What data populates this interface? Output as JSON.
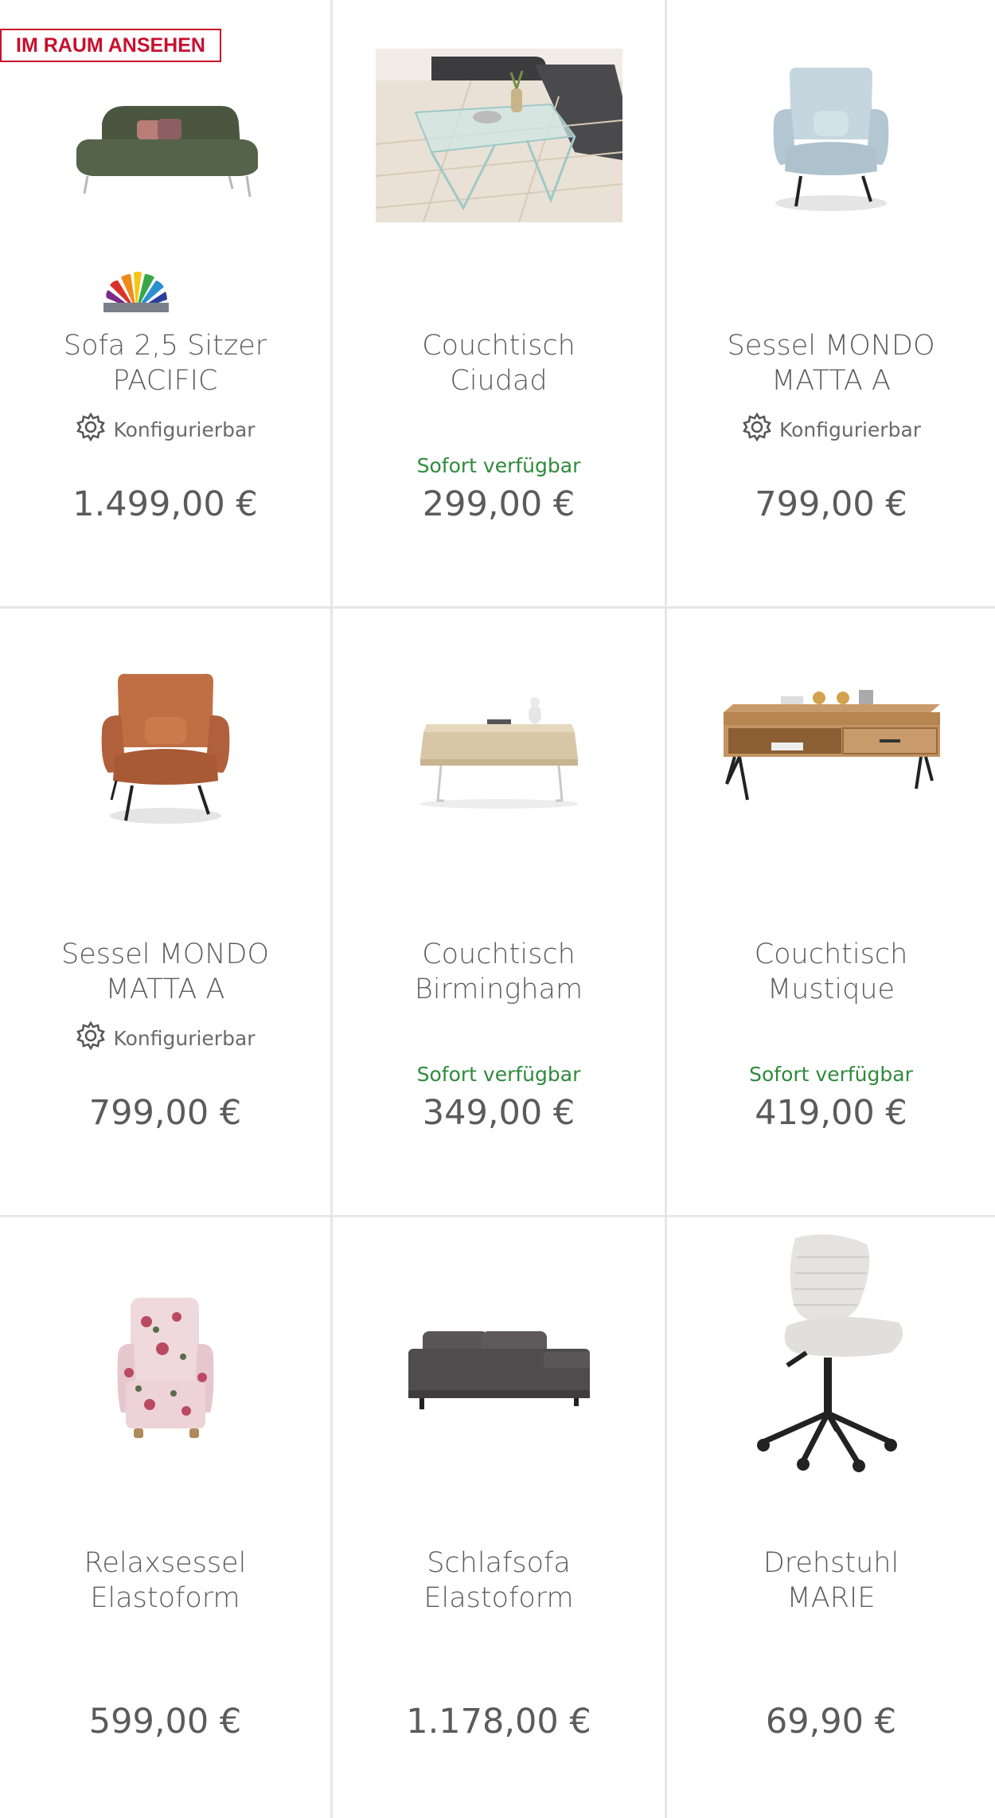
{
  "products": [
    {
      "badge": "IM RAUM ANSEHEN",
      "title_line1": "Sofa 2,5 Sitzer",
      "title_line2": "PACIFIC",
      "config_label": "Konfigurierbar",
      "availability": "",
      "price": "1.499,00 €",
      "image_icon": "sofa-green-image",
      "color_icon": "color-fan-icon"
    },
    {
      "title_line1": "Couchtisch",
      "title_line2": "Ciudad",
      "config_label": "",
      "availability": "Sofort verfügbar",
      "price": "299,00 €",
      "image_icon": "glass-coffee-table-image"
    },
    {
      "title_line1": "Sessel MONDO",
      "title_line2": "MATTA A",
      "config_label": "Konfigurierbar",
      "availability": "",
      "price": "799,00 €",
      "image_icon": "armchair-lightblue-image"
    },
    {
      "title_line1": "Sessel MONDO",
      "title_line2": "MATTA A",
      "config_label": "Konfigurierbar",
      "availability": "",
      "price": "799,00 €",
      "image_icon": "armchair-copper-image"
    },
    {
      "title_line1": "Couchtisch",
      "title_line2": "Birmingham",
      "config_label": "",
      "availability": "Sofort verfügbar",
      "price": "349,00 €",
      "image_icon": "wood-glass-coffee-table-image"
    },
    {
      "title_line1": "Couchtisch",
      "title_line2": "Mustique",
      "config_label": "",
      "availability": "Sofort verfügbar",
      "price": "419,00 €",
      "image_icon": "wood-drawer-coffee-table-image"
    },
    {
      "title_line1": "Relaxsessel",
      "title_line2": "Elastoform",
      "config_label": "",
      "availability": "",
      "price": "599,00 €",
      "image_icon": "floral-wingchair-image"
    },
    {
      "title_line1": "Schlafsofa",
      "title_line2": "Elastoform",
      "config_label": "",
      "availability": "",
      "price": "1.178,00 €",
      "image_icon": "grey-sofa-bed-image"
    },
    {
      "title_line1": "Drehstuhl",
      "title_line2": "MARIE",
      "config_label": "",
      "availability": "",
      "price": "69,90 €",
      "image_icon": "swivel-chair-image"
    }
  ],
  "colors": {
    "badge_red": "#c8102e",
    "availability_green": "#2f8a3c",
    "text_grey": "#5b5b5b",
    "divider": "#e6e6e6"
  }
}
